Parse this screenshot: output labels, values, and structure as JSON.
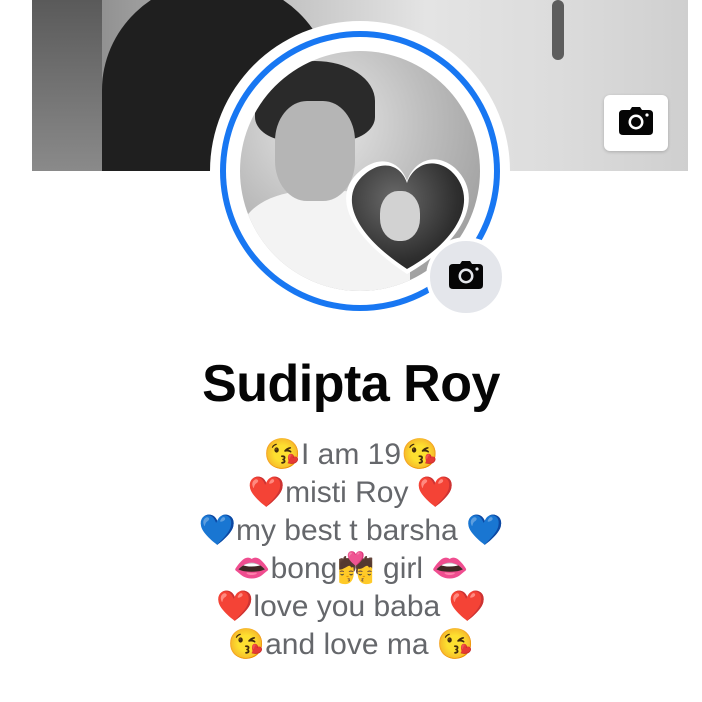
{
  "profile": {
    "name": "Sudipta Roy"
  },
  "bio": {
    "lines": [
      "😘I am 19😘",
      "❤️misti Roy ❤️",
      "💙my best t barsha 💙",
      "👄bong💏 girl 👄",
      "❤️love you baba ❤️",
      "😘and love ma 😘"
    ]
  },
  "icons": {
    "cover_camera": "camera-icon",
    "avatar_camera": "camera-icon"
  },
  "colors": {
    "accent_ring": "#1877f2",
    "name_text": "#050505",
    "bio_text": "#65676b",
    "camera_button_bg": "#e4e6eb"
  }
}
